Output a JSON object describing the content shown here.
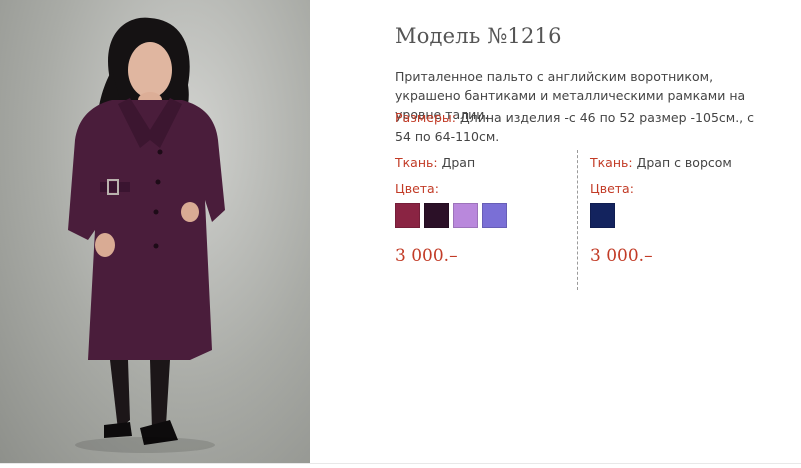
{
  "product": {
    "title": "Модель №1216",
    "description": "Приталенное пальто с английским воротником, украшено бантиками и металлическими рамками на уровне талии.",
    "sizes_label": "Размеры:",
    "sizes_text": " Длина изделия -с 46 по 52 размер -105см., с 54 по 64-110см."
  },
  "variants": [
    {
      "fabric_label": "Ткань:",
      "fabric_value": " Драп",
      "colors_label": "Цвета:",
      "colors": [
        "#8a2443",
        "#2b1027",
        "#b988dc",
        "#7a6fd6"
      ],
      "price": "3 000.–"
    },
    {
      "fabric_label": "Ткань:",
      "fabric_value": " Драп с ворсом",
      "colors_label": "Цвета:",
      "colors": [
        "#13235e"
      ],
      "price": "3 000.–"
    }
  ],
  "theme": {
    "accent": "#c23b26",
    "text": "#444444",
    "title": "#555555"
  }
}
